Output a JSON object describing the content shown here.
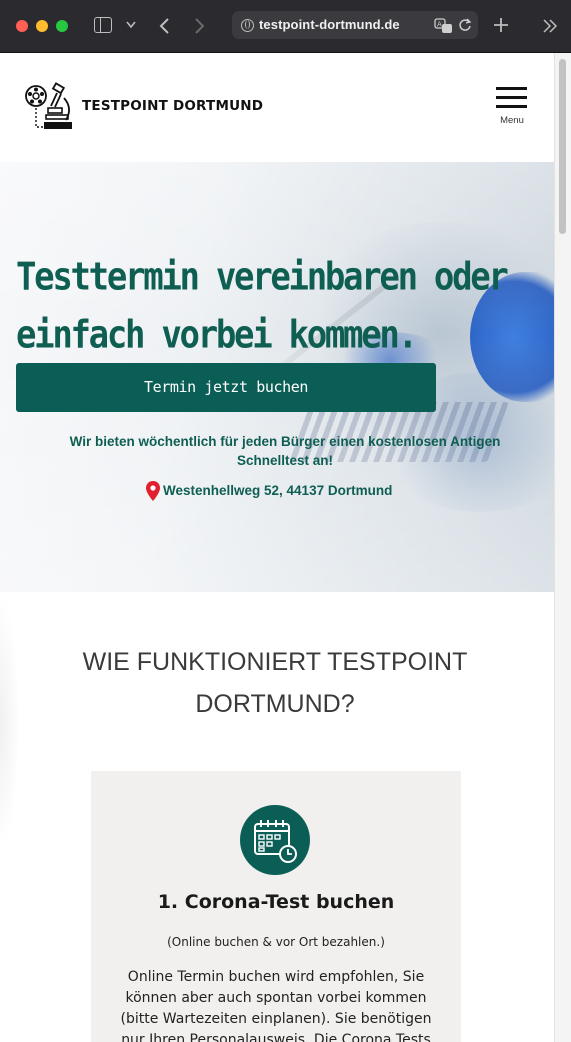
{
  "browser": {
    "url": "testpoint-dortmund.de",
    "icons": [
      "sidebar-icon",
      "chevron-down-icon",
      "back-icon",
      "forward-icon",
      "globe-icon",
      "translate-icon",
      "reload-icon",
      "new-tab-icon",
      "more-tabs-icon"
    ]
  },
  "header": {
    "site_name": "TESTPOINT DORTMUND",
    "menu_label": "Menu"
  },
  "hero": {
    "title": "Testtermin vereinbaren oder einfach vorbei kommen.",
    "cta_label": "Termin jetzt buchen",
    "note": "Wir bieten wöchentlich für jeden Bürger einen kostenlosen Antigen Schnelltest an!",
    "address": "Westenhellweg 52, 44137 Dortmund"
  },
  "how": {
    "title": "WIE FUNKTIONIERT TESTPOINT DORTMUND?",
    "step1": {
      "title": "1. Corona-Test buchen",
      "subtitle": "(Online buchen & vor Ort bezahlen.)",
      "text": "Online Termin buchen wird empfohlen, Sie können aber auch spontan vorbei kommen (bitte Wartezeiten einplanen). Sie benötigen nur Ihren Personalausweis. Die Corona Tests"
    }
  },
  "colors": {
    "brand_green": "#0b5e55",
    "heading_green": "#0f5e52",
    "pin_red": "#e0202f",
    "card_bg": "#f1f0ee"
  }
}
